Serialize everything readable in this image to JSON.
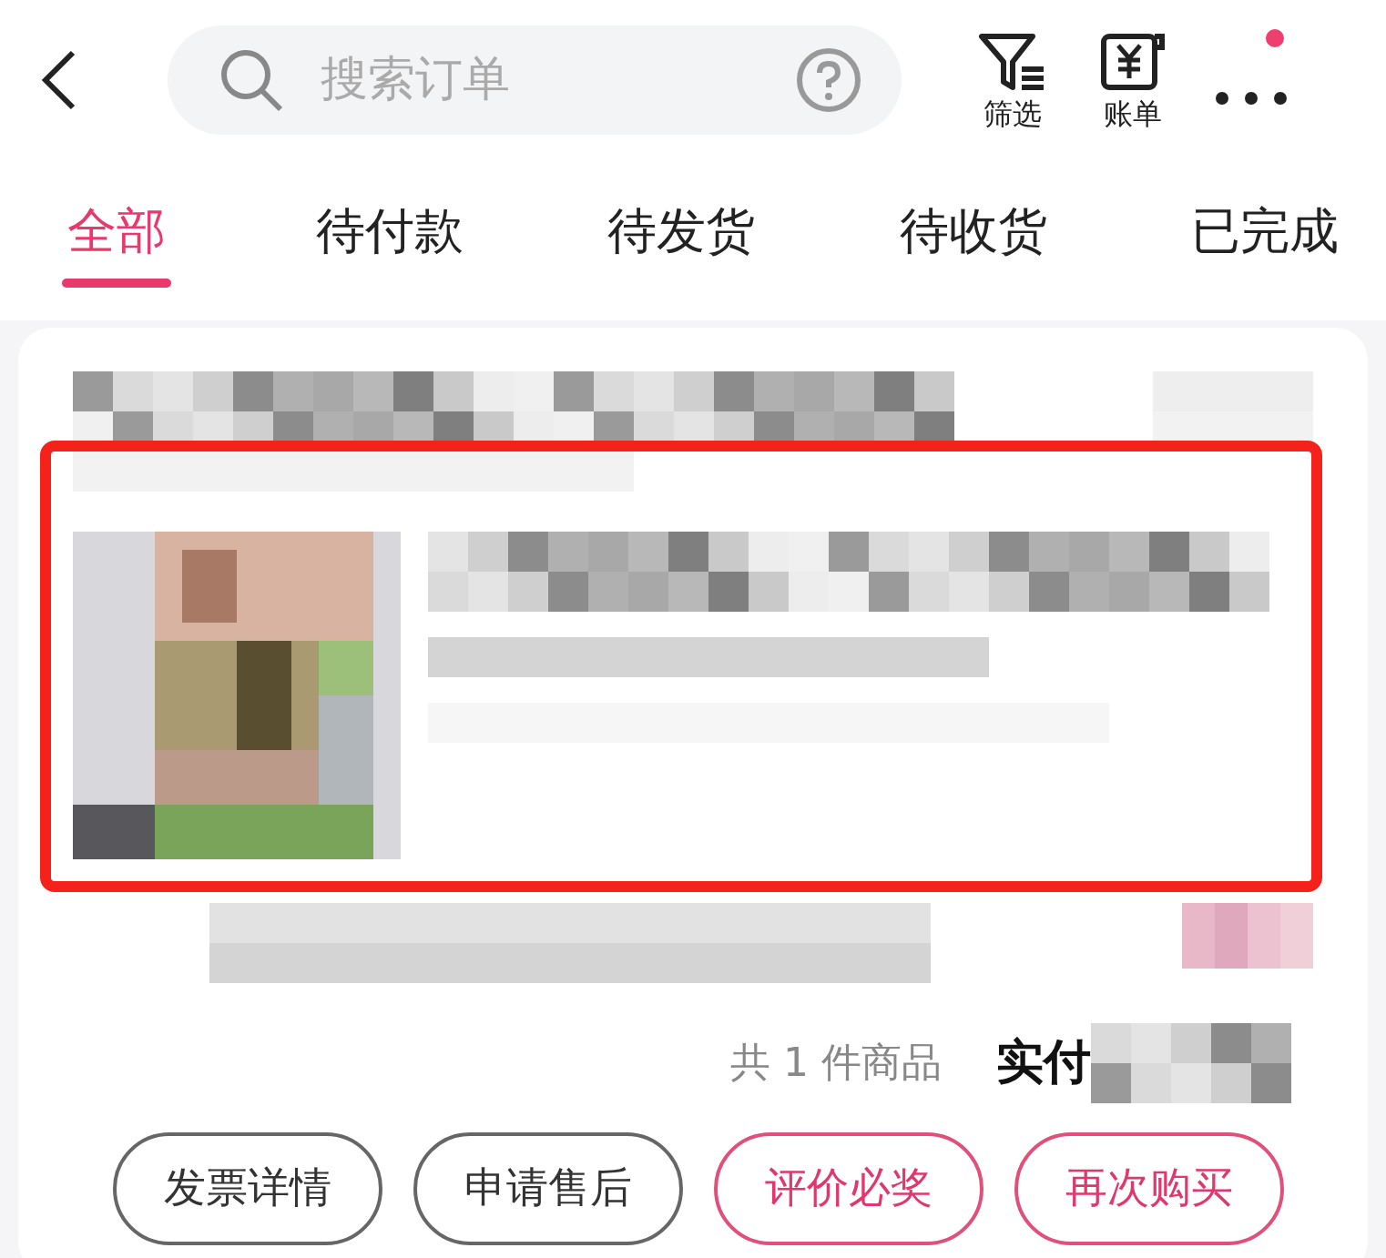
{
  "search": {
    "placeholder": "搜索订单"
  },
  "actions": [
    {
      "label": "筛选",
      "kind": "filter"
    },
    {
      "label": "账单",
      "kind": "bill"
    }
  ],
  "more_menu": {
    "has_badge": true
  },
  "tabs": [
    {
      "label": "全部",
      "selected": true
    },
    {
      "label": "待付款",
      "selected": false
    },
    {
      "label": "待发货",
      "selected": false
    },
    {
      "label": "待收货",
      "selected": false
    },
    {
      "label": "已完成",
      "selected": false
    }
  ],
  "order": {
    "product": {
      "kind": "picture",
      "highlighted": true
    },
    "item_count": "共 1 件商品",
    "paid_label": "实付",
    "buttons": [
      {
        "label": "发票详情",
        "kind": "default"
      },
      {
        "label": "申请售后",
        "kind": "default"
      },
      {
        "label": "评价必奖",
        "kind": "accent"
      },
      {
        "label": "再次购买",
        "kind": "accent"
      }
    ]
  }
}
